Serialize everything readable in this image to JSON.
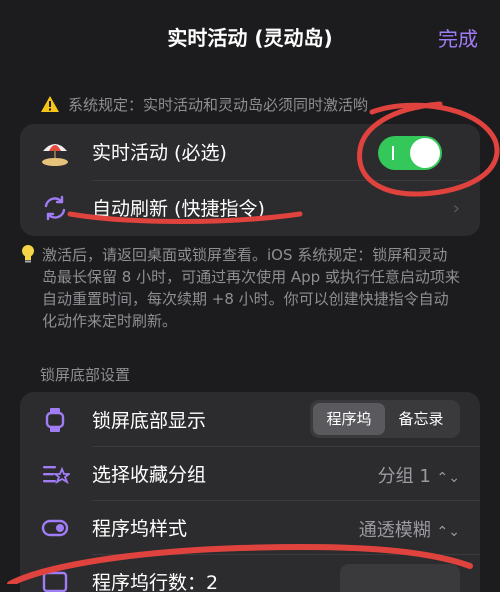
{
  "nav": {
    "title": "实时活动 (灵动岛)",
    "done": "完成"
  },
  "note": "系统规定：实时活动和灵动岛必须同时激活哟",
  "group1": {
    "live": {
      "label": "实时活动 (必选)",
      "enabled": true
    },
    "refresh": {
      "label": "自动刷新 (快捷指令)"
    }
  },
  "info": "激活后，请返回桌面或锁屏查看。iOS 系统规定：锁屏和灵动岛最长保留 8 小时，可通过再次使用 App 或执行任意启动项来自动重置时间，每次续期 +8 小时。你可以创建快捷指令自动化动作来定时刷新。",
  "section": {
    "header": "锁屏底部设置"
  },
  "group2": {
    "display": {
      "label": "锁屏底部显示",
      "options": [
        "程序坞",
        "备忘录"
      ],
      "selected": "程序坞"
    },
    "favorites": {
      "label": "选择收藏分组",
      "value": "分组 1"
    },
    "dock_style": {
      "label": "程序坞样式",
      "value": "通透模糊"
    },
    "dock_rows": {
      "label": "程序坞行数：2"
    }
  },
  "colors": {
    "accent": "#a07cf5",
    "toggle_on": "#34c759",
    "annotation": "#e0433e"
  }
}
